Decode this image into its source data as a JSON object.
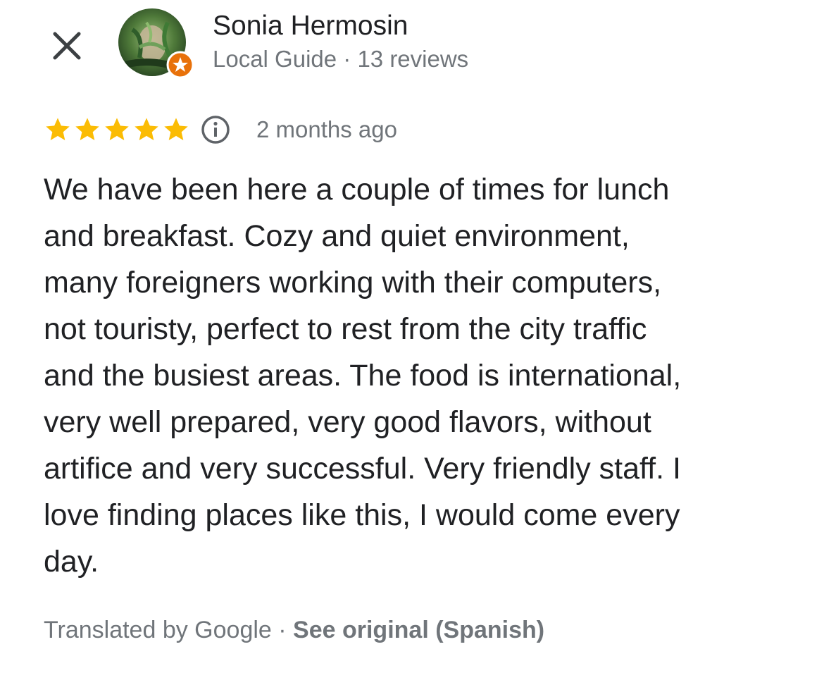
{
  "header": {
    "close_icon": "close-icon",
    "reviewer": {
      "name": "Sonia Hermosin",
      "meta": "Local Guide · 13 reviews",
      "badge_icon": "local-guide-star-icon",
      "badge_color": "#e8710a"
    }
  },
  "review": {
    "rating": 5,
    "max_rating": 5,
    "star_color": "#fbbc04",
    "info_icon": "info-icon",
    "date": "2 months ago",
    "text": "We have been here a couple of times for lunch\nand breakfast. Cozy and quiet environment,\nmany foreigners working with their computers,\nnot touristy, perfect to rest from the city traffic\nand the busiest areas. The food is international,\nvery well prepared, very good flavors, without\nartifice and very successful. Very friendly staff. I\nlove finding places like this, I would come every\nday."
  },
  "footer": {
    "translated_by": "Translated by Google",
    "separator": " · ",
    "see_original": "See original (Spanish)"
  }
}
